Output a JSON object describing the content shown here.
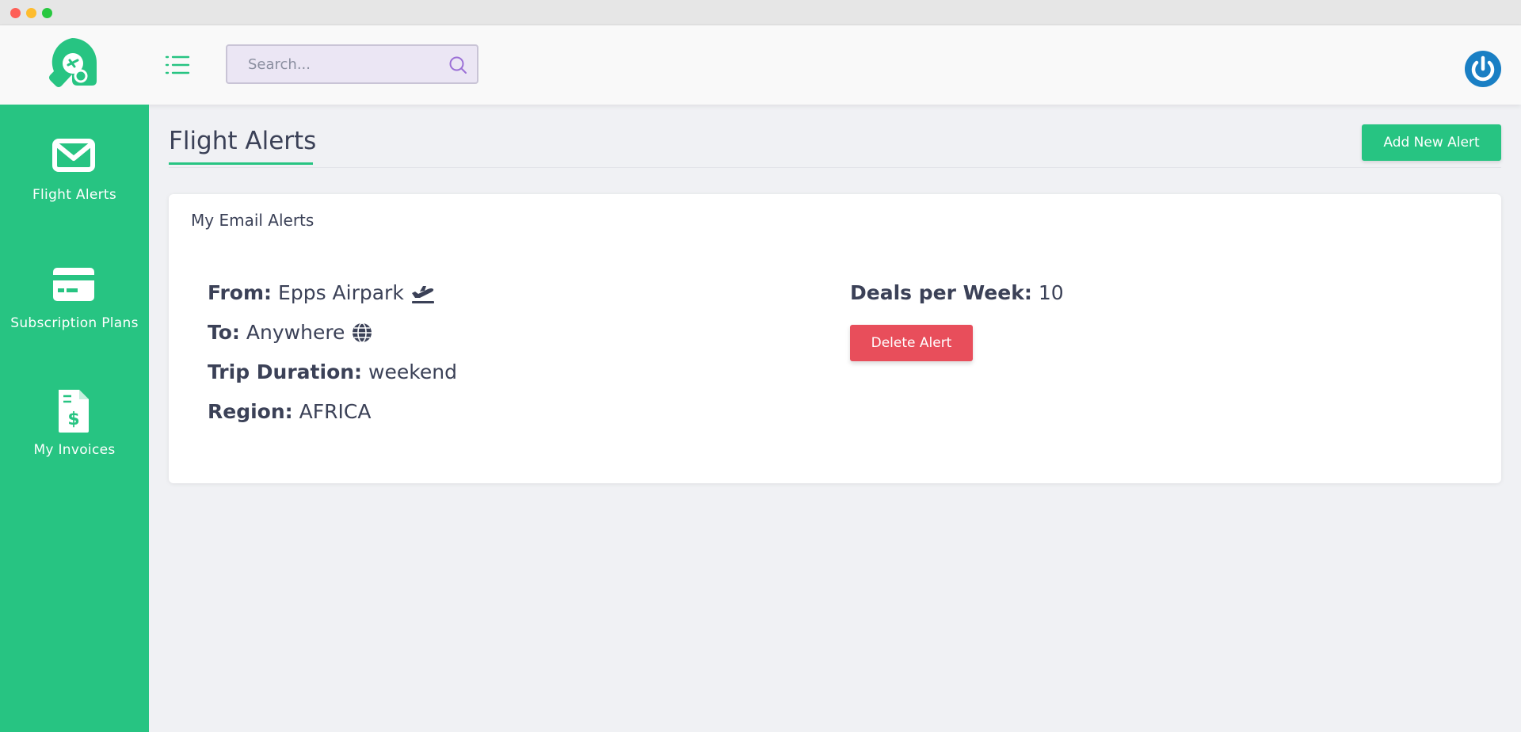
{
  "header": {
    "search_placeholder": "Search..."
  },
  "sidebar": {
    "items": [
      {
        "label": "Flight Alerts",
        "icon": "envelope-icon"
      },
      {
        "label": "Subscription Plans",
        "icon": "credit-card-icon"
      },
      {
        "label": "My Invoices",
        "icon": "invoice-dollar-icon"
      }
    ]
  },
  "main": {
    "title": "Flight Alerts",
    "add_button": "Add New Alert",
    "card": {
      "title": "My Email Alerts",
      "alert": {
        "from_label": "From:",
        "from_value": "Epps Airpark",
        "to_label": "To:",
        "to_value": "Anywhere",
        "duration_label": "Trip Duration:",
        "duration_value": "weekend",
        "region_label": "Region:",
        "region_value": "AFRICA",
        "deals_label": "Deals per Week:",
        "deals_value": "10",
        "delete_button": "Delete Alert"
      }
    }
  },
  "colors": {
    "brand_green": "#27c482",
    "danger_red": "#e84e5b",
    "power_blue": "#1a7fc4",
    "text_dark": "#3b4157"
  }
}
